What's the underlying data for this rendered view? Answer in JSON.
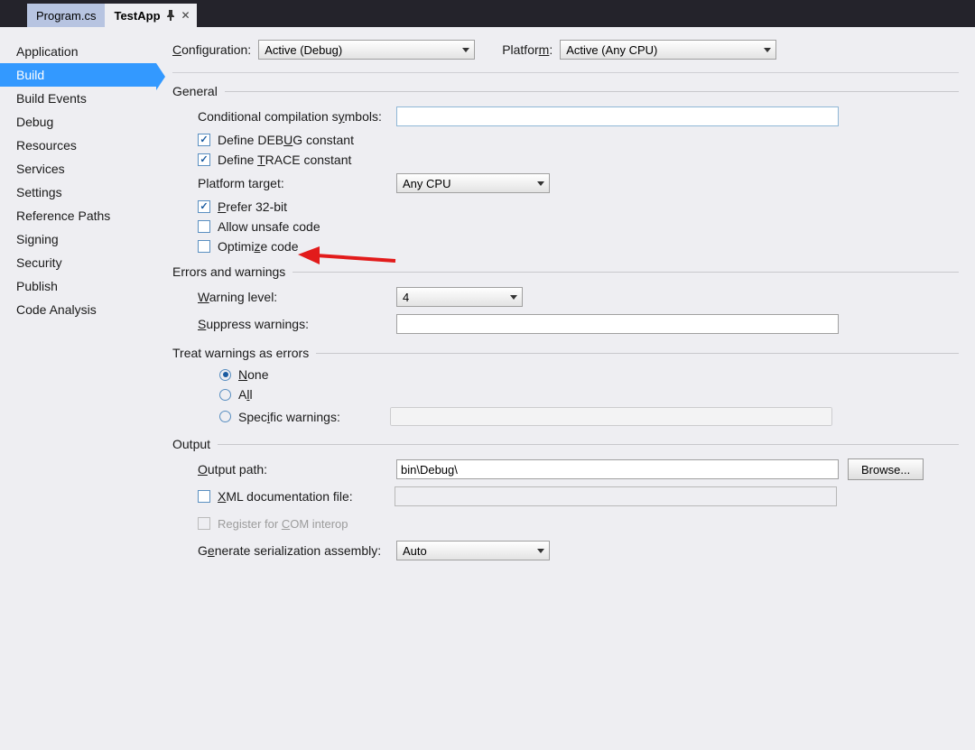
{
  "tabs": {
    "inactive": "Program.cs",
    "active": "TestApp"
  },
  "sidebar": [
    "Application",
    "Build",
    "Build Events",
    "Debug",
    "Resources",
    "Services",
    "Settings",
    "Reference Paths",
    "Signing",
    "Security",
    "Publish",
    "Code Analysis"
  ],
  "sidebar_selected": "Build",
  "config": {
    "configuration_label": "Configuration:",
    "configuration_value": "Active (Debug)",
    "platform_label": "Platform:",
    "platform_value": "Active (Any CPU)"
  },
  "general": {
    "heading": "General",
    "cond_symbols_label": "Conditional compilation symbols:",
    "cond_symbols_value": "",
    "define_debug": "Define DEBUG constant",
    "define_trace": "Define TRACE constant",
    "platform_target_label": "Platform target:",
    "platform_target_value": "Any CPU",
    "prefer32": "Prefer 32-bit",
    "allow_unsafe": "Allow unsafe code",
    "optimize": "Optimize code"
  },
  "errors": {
    "heading": "Errors and warnings",
    "warning_level_label": "Warning level:",
    "warning_level_value": "4",
    "suppress_label": "Suppress warnings:",
    "suppress_value": ""
  },
  "treat": {
    "heading": "Treat warnings as errors",
    "none": "None",
    "all": "All",
    "specific": "Specific warnings:",
    "specific_value": ""
  },
  "output": {
    "heading": "Output",
    "path_label": "Output path:",
    "path_value": "bin\\Debug\\",
    "browse": "Browse...",
    "xml_doc": "XML documentation file:",
    "xml_doc_value": "",
    "register_com": "Register for COM interop",
    "serialization_label": "Generate serialization assembly:",
    "serialization_value": "Auto"
  }
}
